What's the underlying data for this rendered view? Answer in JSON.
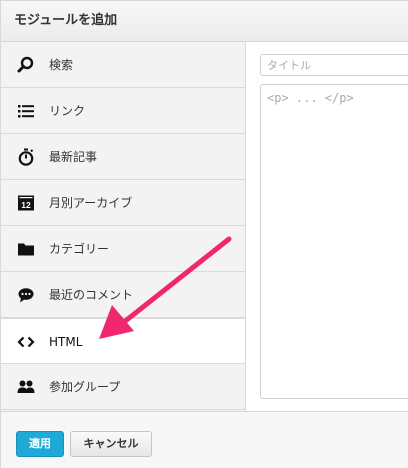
{
  "dialog": {
    "title": "モジュールを追加"
  },
  "sidebar": {
    "items": [
      {
        "label": "検索",
        "icon": "search-icon",
        "active": false
      },
      {
        "label": "リンク",
        "icon": "list-icon",
        "active": false
      },
      {
        "label": "最新記事",
        "icon": "stopwatch-icon",
        "active": false
      },
      {
        "label": "月別アーカイブ",
        "icon": "calendar-icon",
        "active": false
      },
      {
        "label": "カテゴリー",
        "icon": "folder-icon",
        "active": false
      },
      {
        "label": "最近のコメント",
        "icon": "comment-icon",
        "active": false
      },
      {
        "label": "HTML",
        "icon": "code-icon",
        "active": true
      },
      {
        "label": "参加グループ",
        "icon": "group-icon",
        "active": false
      }
    ]
  },
  "editor": {
    "title_placeholder": "タイトル",
    "title_value": "",
    "body_placeholder": "<p> ... </p>",
    "body_value": ""
  },
  "footer": {
    "apply_label": "適用",
    "cancel_label": "キャンセル"
  },
  "colors": {
    "apply_button": "#1fa9d6",
    "annotation_arrow": "#f0266f",
    "sidebar_bg": "#f3f3f3",
    "active_item_bg": "#ffffff"
  }
}
